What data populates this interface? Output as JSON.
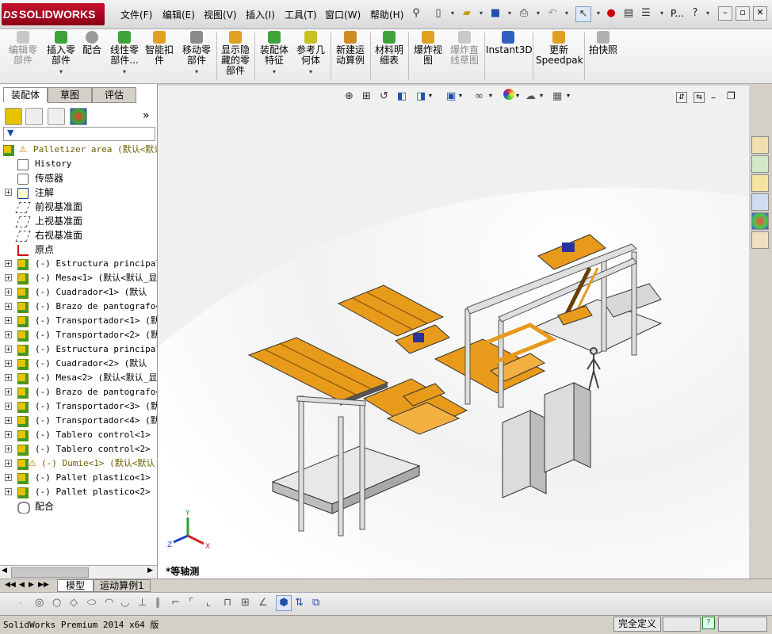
{
  "app": {
    "brand": "SOLIDWORKS",
    "brand_mark": "DS"
  },
  "menu": [
    "文件(F)",
    "编辑(E)",
    "视图(V)",
    "插入(I)",
    "工具(T)",
    "窗口(W)",
    "帮助(H)"
  ],
  "quick_access": {
    "more_label": "P..."
  },
  "command_manager": [
    {
      "label": "编辑零\n部件",
      "icon": "edit-component-icon",
      "enabled": false,
      "dropdown": false
    },
    {
      "label": "插入零\n部件",
      "icon": "insert-component-icon",
      "enabled": true,
      "dropdown": true
    },
    {
      "label": "配合",
      "icon": "mate-icon",
      "enabled": true,
      "dropdown": false
    },
    {
      "label": "线性零\n部件...",
      "icon": "linear-pattern-icon",
      "enabled": true,
      "dropdown": true
    },
    {
      "label": "智能扣\n件",
      "icon": "smart-fasteners-icon",
      "enabled": true,
      "dropdown": false
    },
    {
      "label": "移动零\n部件",
      "icon": "move-component-icon",
      "enabled": true,
      "dropdown": true
    },
    {
      "label": "显示隐\n藏的零\n部件",
      "icon": "show-hidden-icon",
      "enabled": true,
      "dropdown": false
    },
    {
      "label": "装配体\n特征",
      "icon": "assembly-features-icon",
      "enabled": true,
      "dropdown": true
    },
    {
      "label": "参考几\n何体",
      "icon": "reference-geometry-icon",
      "enabled": true,
      "dropdown": true
    },
    {
      "label": "新建运\n动算例",
      "icon": "new-motion-study-icon",
      "enabled": true,
      "dropdown": false
    },
    {
      "label": "材料明\n细表",
      "icon": "bom-icon",
      "enabled": true,
      "dropdown": false
    },
    {
      "label": "爆炸视\n图",
      "icon": "exploded-view-icon",
      "enabled": true,
      "dropdown": false
    },
    {
      "label": "爆炸直\n线草图",
      "icon": "explode-line-sketch-icon",
      "enabled": false,
      "dropdown": false
    },
    {
      "label": "Instant3D",
      "icon": "instant3d-icon",
      "enabled": true,
      "dropdown": false
    },
    {
      "label": "更新\nSpeedpak",
      "icon": "speedpak-icon",
      "enabled": true,
      "dropdown": false
    },
    {
      "label": "拍快照",
      "icon": "snapshot-icon",
      "enabled": true,
      "dropdown": false
    }
  ],
  "manager_tabs": [
    "装配体",
    "草图",
    "评估"
  ],
  "tree": {
    "root": "Palletizer area (默认<默认",
    "items": [
      {
        "label": "History",
        "icon": "history-icon",
        "expand": false,
        "mono": true
      },
      {
        "label": "传感器",
        "icon": "sensors-icon",
        "expand": false,
        "mono": false
      },
      {
        "label": "注解",
        "icon": "annotations-icon",
        "expand": true,
        "mono": false
      },
      {
        "label": "前视基准面",
        "icon": "plane-icon",
        "expand": false,
        "mono": false
      },
      {
        "label": "上视基准面",
        "icon": "plane-icon",
        "expand": false,
        "mono": false
      },
      {
        "label": "右视基准面",
        "icon": "plane-icon",
        "expand": false,
        "mono": false
      },
      {
        "label": "原点",
        "icon": "origin-icon",
        "expand": false,
        "mono": false
      },
      {
        "label": "(-) Estructura principal<",
        "icon": "component-icon",
        "expand": true,
        "mono": true
      },
      {
        "label": "(-) Mesa<1> (默认<默认_显",
        "icon": "component-icon",
        "expand": true,
        "mono": true
      },
      {
        "label": "(-) Cuadrador<1> (默认",
        "icon": "component-icon",
        "expand": true,
        "mono": true
      },
      {
        "label": "(-) Brazo de pantografo<1",
        "icon": "component-icon",
        "expand": true,
        "mono": true
      },
      {
        "label": "(-) Transportador<1> (默认",
        "icon": "component-icon",
        "expand": true,
        "mono": true
      },
      {
        "label": "(-) Transportador<2> (默认",
        "icon": "component-icon",
        "expand": true,
        "mono": true
      },
      {
        "label": "(-) Estructura principal<",
        "icon": "component-icon",
        "expand": true,
        "mono": true
      },
      {
        "label": "(-) Cuadrador<2> (默认",
        "icon": "component-icon",
        "expand": true,
        "mono": true
      },
      {
        "label": "(-) Mesa<2> (默认<默认_显",
        "icon": "component-icon",
        "expand": true,
        "mono": true
      },
      {
        "label": "(-) Brazo de pantografo<2",
        "icon": "component-icon",
        "expand": true,
        "mono": true
      },
      {
        "label": "(-) Transportador<3> (默认",
        "icon": "component-icon",
        "expand": true,
        "mono": true
      },
      {
        "label": "(-) Transportador<4> (默认",
        "icon": "component-icon",
        "expand": true,
        "mono": true
      },
      {
        "label": "(-) Tablero control<1> (默",
        "icon": "part-icon",
        "expand": true,
        "mono": true
      },
      {
        "label": "(-) Tablero control<2> (默",
        "icon": "part-icon",
        "expand": true,
        "mono": true
      },
      {
        "label": "(-) Dumie<1> (默认<默认",
        "icon": "component-warning-icon",
        "expand": true,
        "mono": true,
        "warning": true
      },
      {
        "label": "(-) Pallet plastico<1> (默",
        "icon": "part-icon",
        "expand": true,
        "mono": true
      },
      {
        "label": "(-) Pallet plastico<2> (默",
        "icon": "part-icon",
        "expand": true,
        "mono": true
      },
      {
        "label": "配合",
        "icon": "mates-icon",
        "expand": false,
        "mono": false
      }
    ]
  },
  "viewport": {
    "view_label": "*等轴测",
    "triad": {
      "x": "X",
      "y": "Y",
      "z": "Z"
    }
  },
  "bottom_tabs": [
    "模型",
    "运动算例1"
  ],
  "status": {
    "app_version": "SolidWorks Premium 2014 x64 版",
    "state": "完全定义"
  },
  "colors": {
    "accent": "#c8102e",
    "machine_orange": "#e89a1a",
    "frame_gray": "#d8d8d8"
  }
}
